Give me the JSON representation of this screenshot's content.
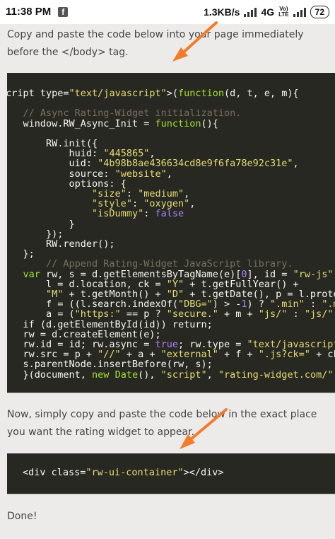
{
  "status_bar": {
    "time": "11:38 PM",
    "app_icon": "facebook-icon",
    "speed": "1.3KB/s",
    "network": "4G",
    "volte_top": "Vo)",
    "volte_bottom": "LTE",
    "battery": "72"
  },
  "instructions": {
    "first": "Copy and paste the code below into your page immediately before the </body> tag.",
    "second": "Now, simply copy and paste the code below in the exact place you want the rating widget to appear.",
    "done": "Done!"
  },
  "code_block_1": {
    "lines": [
      [
        [
          "plain",
          "script type="
        ],
        [
          "str",
          "\"text/javascript\""
        ],
        [
          "plain",
          ">("
        ],
        [
          "kw",
          "function"
        ],
        [
          "plain",
          "(d, t, e, m){"
        ]
      ],
      [],
      [
        [
          "plain",
          "    "
        ],
        [
          "com",
          "// Async Rating-Widget initialization."
        ]
      ],
      [
        [
          "plain",
          "    window.RW_Async_Init = "
        ],
        [
          "kw",
          "function"
        ],
        [
          "plain",
          "(){"
        ]
      ],
      [],
      [
        [
          "plain",
          "        RW.init({"
        ]
      ],
      [
        [
          "plain",
          "            huid: "
        ],
        [
          "str",
          "\"445865\""
        ],
        [
          "plain",
          ","
        ]
      ],
      [
        [
          "plain",
          "            uid: "
        ],
        [
          "str",
          "\"4b98b8ae436634cd8e9f6fa78e92c31e\""
        ],
        [
          "plain",
          ","
        ]
      ],
      [
        [
          "plain",
          "            source: "
        ],
        [
          "str",
          "\"website\""
        ],
        [
          "plain",
          ","
        ]
      ],
      [
        [
          "plain",
          "            options: {"
        ]
      ],
      [
        [
          "plain",
          "                "
        ],
        [
          "str",
          "\"size\""
        ],
        [
          "plain",
          ": "
        ],
        [
          "str",
          "\"medium\""
        ],
        [
          "plain",
          ","
        ]
      ],
      [
        [
          "plain",
          "                "
        ],
        [
          "str",
          "\"style\""
        ],
        [
          "plain",
          ": "
        ],
        [
          "str",
          "\"oxygen\""
        ],
        [
          "plain",
          ","
        ]
      ],
      [
        [
          "plain",
          "                "
        ],
        [
          "str",
          "\"isDummy\""
        ],
        [
          "plain",
          ": "
        ],
        [
          "num",
          "false"
        ]
      ],
      [
        [
          "plain",
          "            }"
        ]
      ],
      [
        [
          "plain",
          "        });"
        ]
      ],
      [
        [
          "plain",
          "        RW.render();"
        ]
      ],
      [
        [
          "plain",
          "    };"
        ]
      ],
      [
        [
          "plain",
          "        "
        ],
        [
          "com",
          "// Append Rating-Widget JavaScript library."
        ]
      ],
      [
        [
          "plain",
          "    "
        ],
        [
          "kw",
          "var"
        ],
        [
          "plain",
          " rw, s = d.getElementsByTagName(e)["
        ],
        [
          "num",
          "0"
        ],
        [
          "plain",
          "], id = "
        ],
        [
          "str",
          "\"rw-js\""
        ]
      ],
      [
        [
          "plain",
          "        l = d.location, ck = "
        ],
        [
          "str",
          "\"Y\""
        ],
        [
          "plain",
          " + t.getFullYear() +"
        ]
      ],
      [
        [
          "plain",
          "        "
        ],
        [
          "str",
          "\"M\""
        ],
        [
          "plain",
          " + t.getMonth() + "
        ],
        [
          "str",
          "\"D\""
        ],
        [
          "plain",
          " + t.getDate(), p = l.protocol"
        ]
      ],
      [
        [
          "plain",
          "        f = ((l.search.indexOf("
        ],
        [
          "str",
          "\"DBG=\""
        ],
        [
          "plain",
          ") > -"
        ],
        [
          "num",
          "1"
        ],
        [
          "plain",
          ") ? "
        ],
        [
          "str",
          "\".min\""
        ],
        [
          "plain",
          " : "
        ],
        [
          "str",
          "\".min\""
        ]
      ],
      [
        [
          "plain",
          "        a = ("
        ],
        [
          "str",
          "\"https:\""
        ],
        [
          "plain",
          " == p ? "
        ],
        [
          "str",
          "\"secure.\""
        ],
        [
          "plain",
          " + m + "
        ],
        [
          "str",
          "\"js/\""
        ],
        [
          "plain",
          " : "
        ],
        [
          "str",
          "\"js/\""
        ]
      ],
      [
        [
          "plain",
          "    if (d.getElementById(id)) return;"
        ]
      ],
      [
        [
          "plain",
          "    rw = d.createElement(e);"
        ]
      ],
      [
        [
          "plain",
          "    rw.id = id; rw.async = "
        ],
        [
          "num",
          "true"
        ],
        [
          "plain",
          "; rw.type = "
        ],
        [
          "str",
          "\"text/javascript\""
        ]
      ],
      [
        [
          "plain",
          "    rw.src = p + "
        ],
        [
          "str",
          "\"//\""
        ],
        [
          "plain",
          " + a + "
        ],
        [
          "str",
          "\"external\""
        ],
        [
          "plain",
          " + f + "
        ],
        [
          "str",
          "\".js?ck=\""
        ],
        [
          "plain",
          " + ck"
        ]
      ],
      [
        [
          "plain",
          "    s.parentNode.insertBefore(rw, s);"
        ]
      ],
      [
        [
          "plain",
          "    }(document, "
        ],
        [
          "kw",
          "new"
        ],
        [
          "plain",
          " "
        ],
        [
          "kw",
          "Date"
        ],
        [
          "plain",
          "(), "
        ],
        [
          "str",
          "\"script\""
        ],
        [
          "plain",
          ", "
        ],
        [
          "str",
          "\"rating-widget.com/\""
        ]
      ]
    ]
  },
  "code_block_2": {
    "lines": [
      [
        [
          "plain",
          "<div class="
        ],
        [
          "str",
          "\"rw-ui-container\""
        ],
        [
          "plain",
          "></div>"
        ]
      ]
    ]
  },
  "colors": {
    "arrow": "#f47b2a",
    "code_bg": "#272822",
    "page_bg": "#ecebea"
  }
}
